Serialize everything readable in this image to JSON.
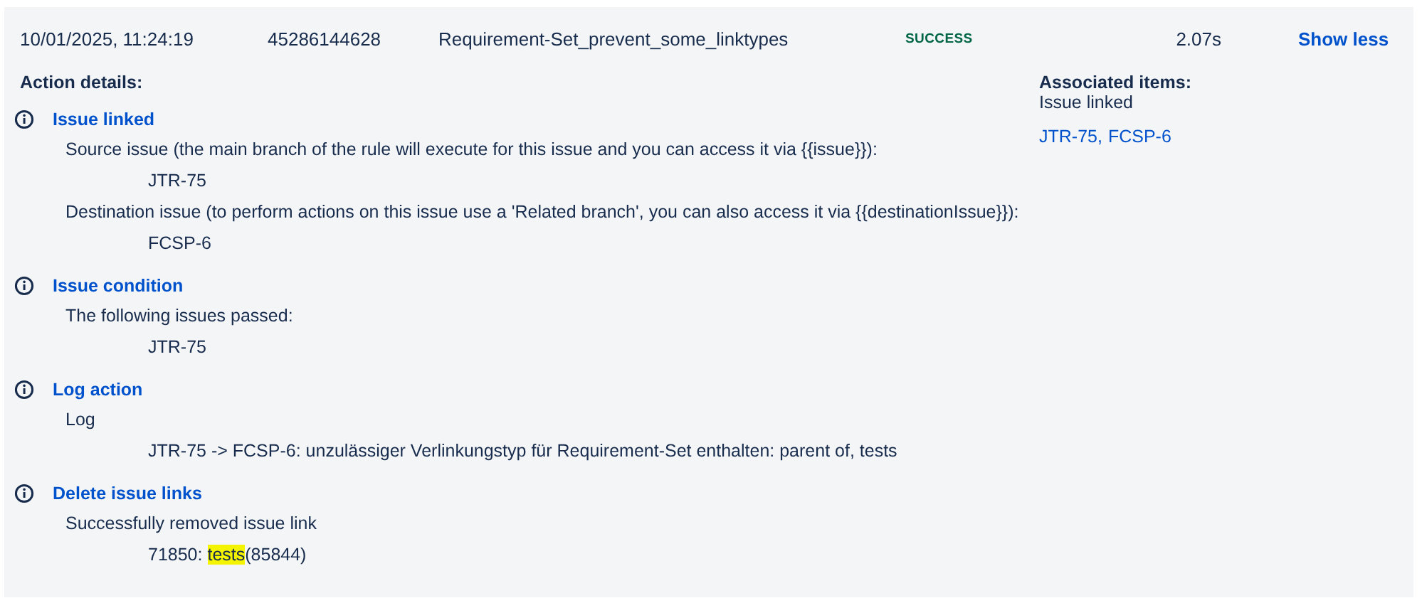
{
  "execution": {
    "date": "10/01/2025, 11:24:19",
    "id": "45286144628",
    "rule": "Requirement-Set_prevent_some_linktypes",
    "status": "SUCCESS",
    "duration": "2.07s",
    "toggle": "Show less"
  },
  "action_details": {
    "title": "Action details:",
    "actions": [
      {
        "title": "Issue linked",
        "lines": [
          {
            "kind": "text",
            "segments": [
              {
                "text": "Source issue (the main branch of the rule will execute for this issue and you can access it via {{issue}}):",
                "highlighted": false
              }
            ]
          },
          {
            "kind": "value",
            "segments": [
              {
                "text": "JTR-75",
                "highlighted": false
              }
            ]
          },
          {
            "kind": "text",
            "segments": [
              {
                "text": "Destination issue (to perform actions on this issue use a 'Related branch', you can also access it via {{destinationIssue}}):",
                "highlighted": false
              }
            ]
          },
          {
            "kind": "value",
            "segments": [
              {
                "text": "FCSP-6",
                "highlighted": false
              }
            ]
          }
        ]
      },
      {
        "title": "Issue condition",
        "lines": [
          {
            "kind": "text",
            "segments": [
              {
                "text": "The following issues passed:",
                "highlighted": false
              }
            ]
          },
          {
            "kind": "value",
            "segments": [
              {
                "text": "JTR-75",
                "highlighted": false
              }
            ]
          }
        ]
      },
      {
        "title": "Log action",
        "lines": [
          {
            "kind": "text",
            "segments": [
              {
                "text": "Log",
                "highlighted": false
              }
            ]
          },
          {
            "kind": "value",
            "segments": [
              {
                "text": "JTR-75 -> FCSP-6: unzulässiger Verlinkungstyp für Requirement-Set enthalten: parent of, tests",
                "highlighted": false
              }
            ]
          }
        ]
      },
      {
        "title": "Delete issue links",
        "lines": [
          {
            "kind": "text",
            "segments": [
              {
                "text": "Successfully removed issue link",
                "highlighted": false
              }
            ]
          },
          {
            "kind": "value",
            "segments": [
              {
                "text": "71850: ",
                "highlighted": false
              },
              {
                "text": "tests",
                "highlighted": true
              },
              {
                "text": "(85844)",
                "highlighted": false
              }
            ]
          }
        ]
      }
    ]
  },
  "associated_items": {
    "title": "Associated items:",
    "subtitle": "Issue linked",
    "links": [
      "JTR-75,",
      "FCSP-6"
    ]
  }
}
